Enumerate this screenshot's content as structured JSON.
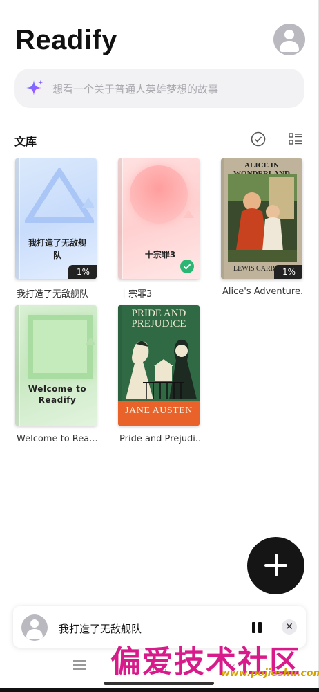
{
  "app": {
    "title": "Readify"
  },
  "search": {
    "placeholder": "想看一个关于普通人英雄梦想的故事"
  },
  "library": {
    "title": "文库",
    "books": [
      {
        "label": "我打造了无敌舰队",
        "cover_text": "我打造了无敌舰队",
        "progress": "1%"
      },
      {
        "label": "十宗罪3",
        "cover_text": "十宗罪3",
        "status": "completed"
      },
      {
        "label": "Alice's Adventure...",
        "cover_title": "ALICE IN WONDERLAND",
        "cover_author": "LEWIS CARROLL",
        "progress": "1%"
      },
      {
        "label": "Welcome to Rea...",
        "cover_text_1": "Welcome to",
        "cover_text_2": "Readify"
      },
      {
        "label": "Pride and Prejudi...",
        "cover_title_1": "PRIDE AND",
        "cover_title_2": "PREJUDICE",
        "cover_author": "JANE AUSTEN"
      }
    ]
  },
  "player": {
    "title": "我打造了无敌舰队",
    "close_label": "✕"
  },
  "watermark": {
    "text": "偏爱技术社区",
    "url": "www.pojieshu.com"
  },
  "colors": {
    "accent": "#151515",
    "check": "#2bb673",
    "orange": "#e8622a",
    "green": "#2f6a45"
  },
  "icons": [
    "sparkle-icon",
    "avatar-icon",
    "check-circle-icon",
    "list-view-icon",
    "plus-icon",
    "pause-icon",
    "close-icon",
    "menu-icon",
    "home-icon",
    "back-icon"
  ]
}
